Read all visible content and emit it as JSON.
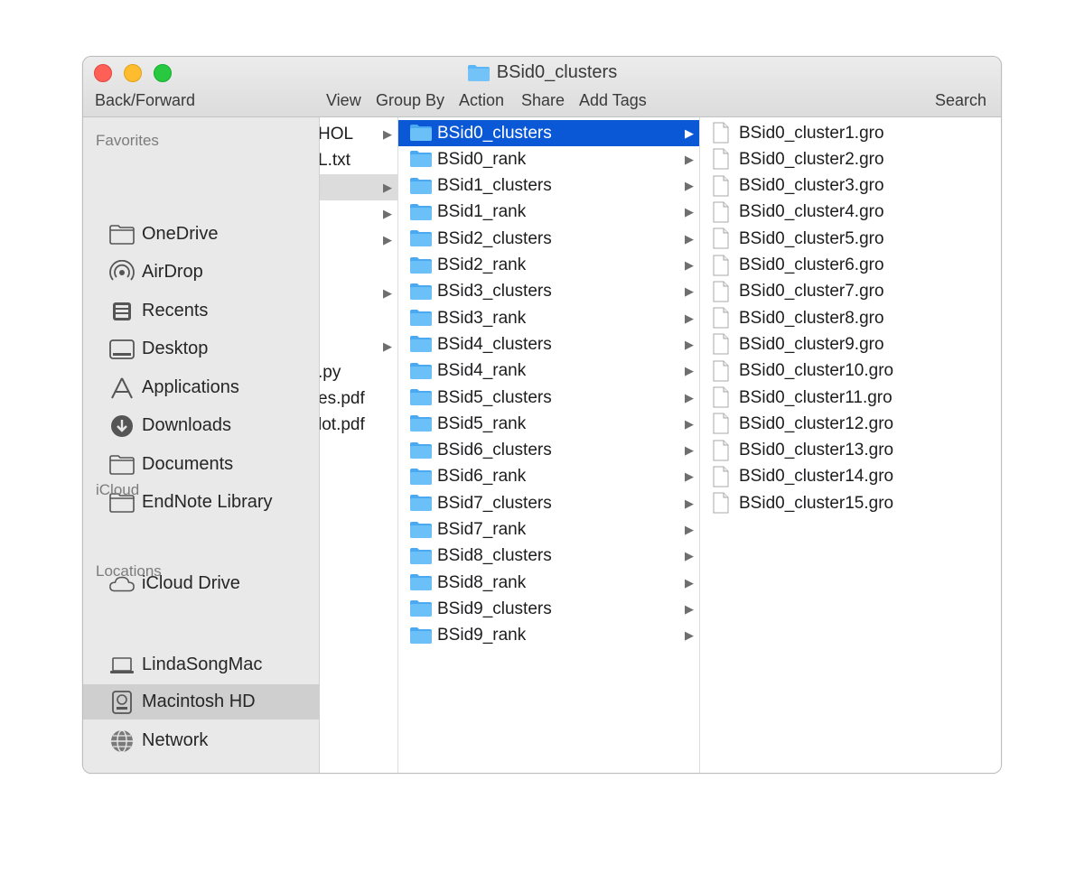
{
  "window": {
    "title": "BSid0_clusters"
  },
  "toolbar": {
    "back_forward": "Back/Forward",
    "view": "View",
    "group_by": "Group By",
    "action": "Action",
    "share": "Share",
    "add_tags": "Add Tags",
    "search": "Search"
  },
  "sidebar": {
    "favorites_header": "Favorites",
    "favorites": [
      {
        "label": "OneDrive",
        "icon": "folder-icon"
      },
      {
        "label": "AirDrop",
        "icon": "airdrop-icon"
      },
      {
        "label": "Recents",
        "icon": "recents-icon"
      },
      {
        "label": "Desktop",
        "icon": "desktop-icon"
      },
      {
        "label": "Applications",
        "icon": "applications-icon"
      },
      {
        "label": "Downloads",
        "icon": "downloads-icon"
      },
      {
        "label": "Documents",
        "icon": "folder-icon"
      },
      {
        "label": "EndNote Library",
        "icon": "folder-icon"
      }
    ],
    "icloud_header": "iCloud",
    "icloud": [
      {
        "label": "iCloud Drive",
        "icon": "cloud-icon"
      }
    ],
    "locations_header": "Locations",
    "locations": [
      {
        "label": "LindaSongMac",
        "icon": "laptop-icon"
      },
      {
        "label": "Macintosh HD",
        "icon": "hard-drive-icon",
        "selected": true
      },
      {
        "label": "Network",
        "icon": "network-icon"
      }
    ]
  },
  "column1": {
    "items": [
      "HOL",
      "L.txt",
      "",
      "",
      "",
      "",
      "",
      "",
      "",
      ".py",
      "es.pdf",
      "lot.pdf"
    ]
  },
  "column2": {
    "items": [
      "BSid0_clusters",
      "BSid0_rank",
      "BSid1_clusters",
      "BSid1_rank",
      "BSid2_clusters",
      "BSid2_rank",
      "BSid3_clusters",
      "BSid3_rank",
      "BSid4_clusters",
      "BSid4_rank",
      "BSid5_clusters",
      "BSid5_rank",
      "BSid6_clusters",
      "BSid6_rank",
      "BSid7_clusters",
      "BSid7_rank",
      "BSid8_clusters",
      "BSid8_rank",
      "BSid9_clusters",
      "BSid9_rank"
    ],
    "selected": "BSid0_clusters"
  },
  "column3": {
    "items": [
      "BSid0_cluster1.gro",
      "BSid0_cluster2.gro",
      "BSid0_cluster3.gro",
      "BSid0_cluster4.gro",
      "BSid0_cluster5.gro",
      "BSid0_cluster6.gro",
      "BSid0_cluster7.gro",
      "BSid0_cluster8.gro",
      "BSid0_cluster9.gro",
      "BSid0_cluster10.gro",
      "BSid0_cluster11.gro",
      "BSid0_cluster12.gro",
      "BSid0_cluster13.gro",
      "BSid0_cluster14.gro",
      "BSid0_cluster15.gro"
    ]
  },
  "colors": {
    "selection_blue": "#0a58d6",
    "folder_blue": "#5ab6f6",
    "close": "#fe5f57",
    "minimize": "#febc2e",
    "maximize": "#28c840"
  }
}
